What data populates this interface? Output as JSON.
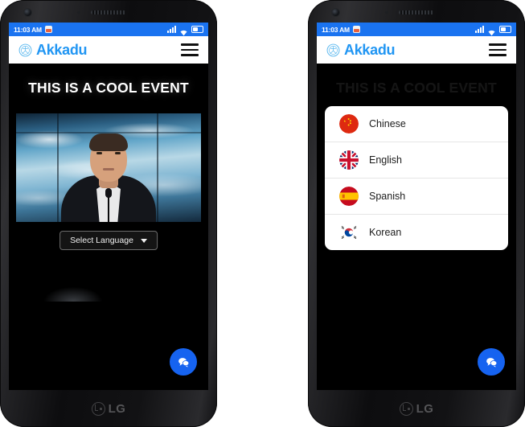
{
  "page": {
    "background_color": "#ffffff",
    "device_name": "LG",
    "phone_count": 2
  },
  "status_bar": {
    "time": "11:03 AM",
    "background_color": "#1a73f0",
    "notification_icon": "notification-icon",
    "signal_icon": "signal-bars-icon",
    "wifi_icon": "wifi-icon",
    "battery_icon": "battery-icon"
  },
  "app_bar": {
    "brand_name": "Akkadu",
    "brand_color": "#2196f3",
    "logo_icon": "akkadu-logo-icon",
    "menu_icon": "hamburger-menu-icon"
  },
  "main": {
    "event_title": "THIS IS A COOL EVENT",
    "select_language_label": "Select Language",
    "dropdown_caret_icon": "chevron-down-icon",
    "chat_fab_icon": "chat-bubble-icon",
    "chat_fab_color": "#1663f0"
  },
  "language_dropdown": {
    "open_on_phone": "right",
    "options": [
      {
        "label": "Chinese",
        "flag": "flag-china-icon"
      },
      {
        "label": "English",
        "flag": "flag-uk-icon"
      },
      {
        "label": "Spanish",
        "flag": "flag-spain-icon"
      },
      {
        "label": "Korean",
        "flag": "flag-korea-icon"
      }
    ]
  }
}
